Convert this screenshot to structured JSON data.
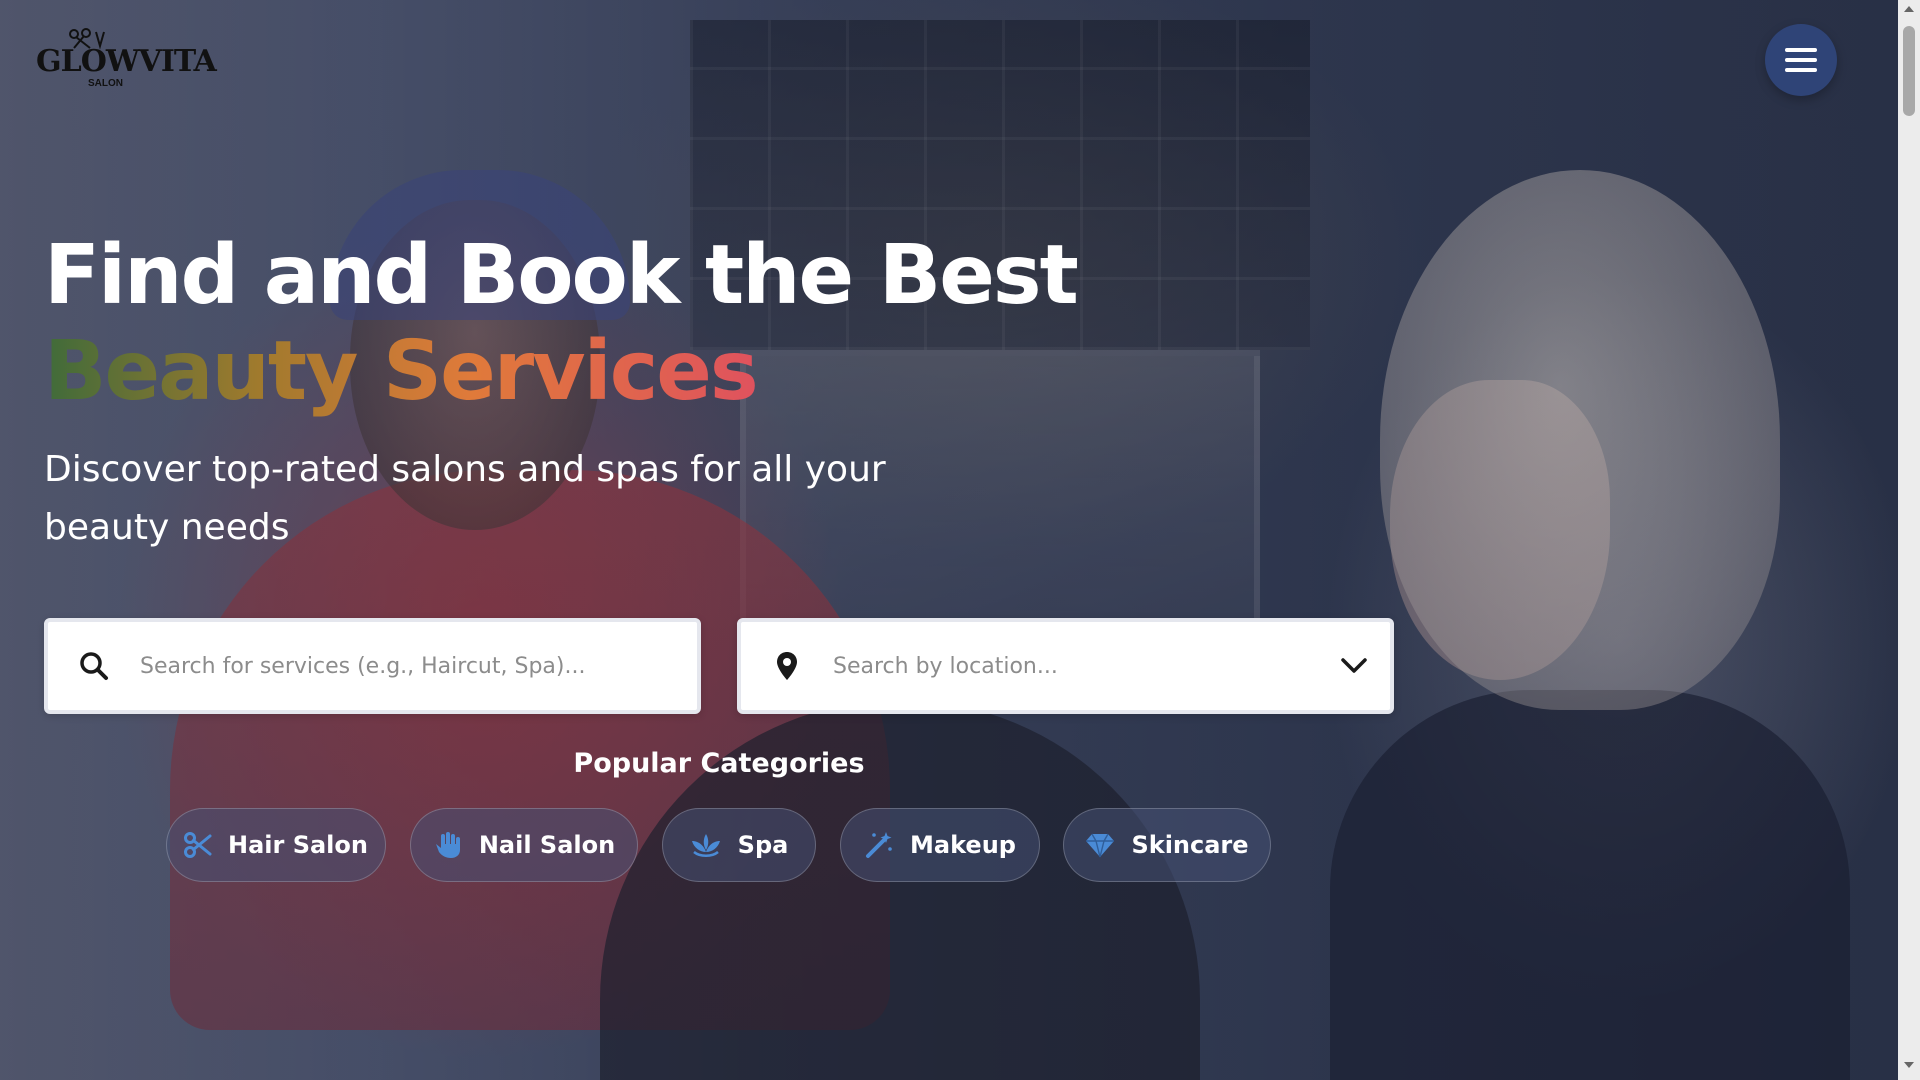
{
  "brand": {
    "logo_text": "GLOWVITA",
    "logo_sub": "SALON"
  },
  "header": {
    "menu_icon": "hamburger-icon"
  },
  "hero": {
    "title_line1": "Find and Book the Best",
    "title_line2": "Beauty Services",
    "subtitle": "Discover top-rated salons and spas for all your beauty needs"
  },
  "search": {
    "service_placeholder": "Search for services (e.g., Haircut, Spa)...",
    "service_value": "",
    "location_placeholder": "Search by location...",
    "location_value": "",
    "service_icon": "search-icon",
    "location_icon": "map-pin-icon",
    "dropdown_icon": "chevron-down-icon"
  },
  "categories": {
    "title": "Popular Categories",
    "items": [
      {
        "label": "Hair Salon",
        "icon": "scissors-icon"
      },
      {
        "label": "Nail Salon",
        "icon": "hand-icon"
      },
      {
        "label": "Spa",
        "icon": "spa-icon"
      },
      {
        "label": "Makeup",
        "icon": "magic-wand-icon"
      },
      {
        "label": "Skincare",
        "icon": "gem-icon"
      }
    ]
  },
  "colors": {
    "accent_icon": "#4a8bd6",
    "menu_button": "#2f4477",
    "accent_gradient": [
      "#3f6b3a",
      "#a07a2d",
      "#e07a3a",
      "#e0525e"
    ]
  }
}
